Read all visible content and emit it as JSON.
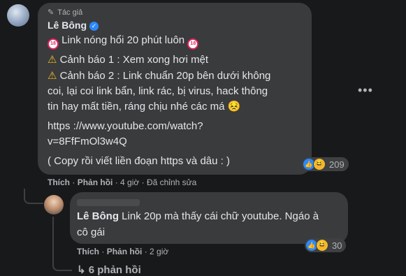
{
  "comment": {
    "badge": "Tác giả",
    "author": "Lê Bông",
    "line1": "Link nóng hổi 20 phút luôn",
    "warning1": "Cảnh báo 1 : Xem xong hơi mệt",
    "warning2_line1": "Cảnh báo 2 : Link chuẩn 20p bên dưới không",
    "warning2_line2": "coi, lại coi link bẩn, link rác, bị virus, hack thông",
    "warning2_line3": "tin hay mất tiền, ráng chịu nhé các má 😣",
    "url_line1": "https ://www.youtube.com/watch?",
    "url_line2": "v=8FfFmOl3w4Q",
    "note": "( Copy rồi viết liền đoạn https và dâu : )",
    "reactions_count": "209",
    "actions": {
      "like": "Thích",
      "reply": "Phản hồi",
      "time": "4 giờ",
      "edited": "Đã chỉnh sửa"
    }
  },
  "reply": {
    "mention": "Lê Bông",
    "text_line1": "Link 20p mà thấy cái chữ youtube. Ngáo à",
    "text_line2": "cô gái",
    "reactions_count": "30",
    "actions": {
      "like": "Thích",
      "reply": "Phản hồi",
      "time": "2 giờ"
    }
  },
  "more_replies": "6 phản hồi",
  "icons": {
    "more": "more-options-icon",
    "verified": "verified-badge-icon",
    "reply_arrow": "reply-arrow-icon"
  },
  "colors": {
    "background": "#18191a",
    "bubble": "#3a3b3c",
    "accent": "#2d88ff"
  }
}
